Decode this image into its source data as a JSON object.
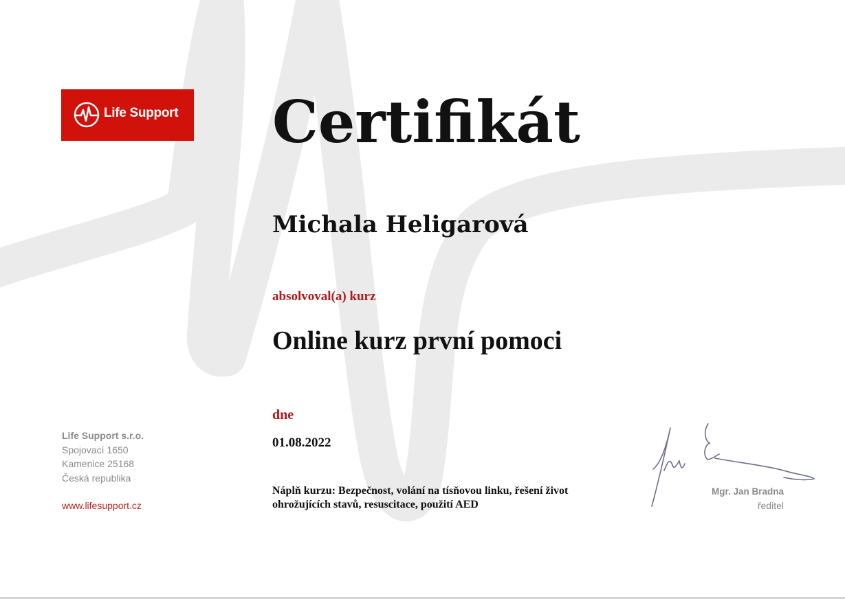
{
  "brand": {
    "logo_text": "Life Support",
    "color": "#d1120b",
    "logo_icon": "heartbeat-icon"
  },
  "certificate": {
    "title": "Certifikát",
    "recipient": "Michala Heligarová",
    "completed_label": "absolvoval(a) kurz",
    "course": "Online kurz první pomoci",
    "date_label": "dne",
    "date": "01.08.2022",
    "content": "Náplň kurzu: Bezpečnost, volání na tísňovou linku, řešení život ohrožujících stavů, resuscitace, použití AED"
  },
  "company": {
    "name": "Life Support s.r.o.",
    "street": "Spojovací 1650",
    "city": "Kamenice 25168",
    "country": "Česká republika",
    "website": "www.lifesupport.cz"
  },
  "signatory": {
    "name": "Mgr. Jan Bradna",
    "role": "ředitel"
  },
  "colors": {
    "accent_red": "#b3181a",
    "text_gray": "#8a8a8a",
    "watermark": "#ebebeb"
  }
}
